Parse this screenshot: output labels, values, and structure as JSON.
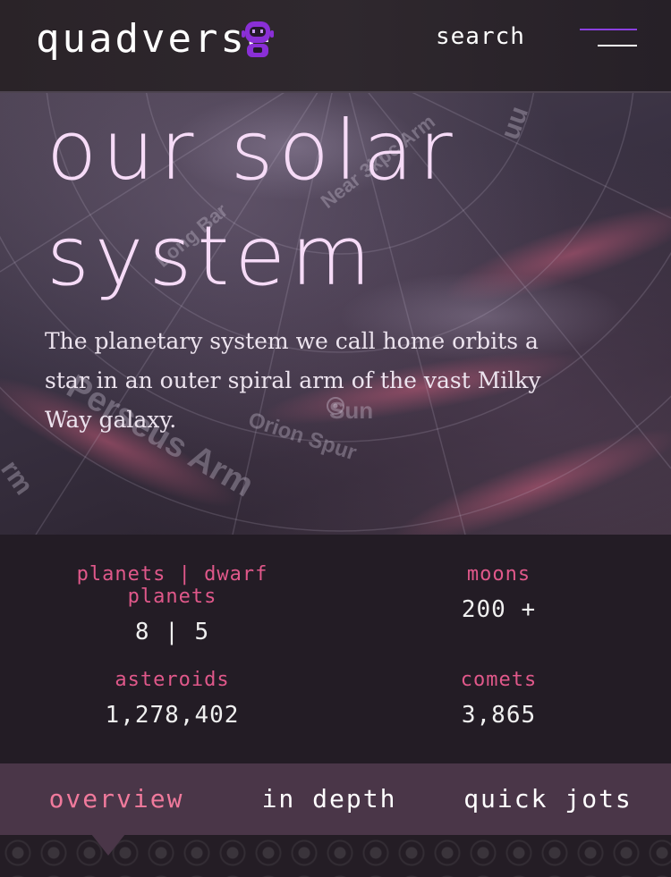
{
  "header": {
    "logo_text": "quadverse",
    "search_label": "search"
  },
  "hero": {
    "title_line1": "our solar",
    "title_line2": "system",
    "description": "The planetary system we call home orbits a star in an outer spiral arm of the vast Milky Way galaxy.",
    "map_labels": {
      "sun": "Sun",
      "orion_spur": "Orion Spur",
      "perseus_arm": "Perseus Arm",
      "near_arm": "Near 3kpc Arm",
      "long_bar": "Long Bar",
      "arm_fragment_left": "rm",
      "arm_fragment_right": "uu"
    }
  },
  "stats": [
    {
      "label": "planets | dwarf planets",
      "value": "8 | 5"
    },
    {
      "label": "moons",
      "value": "200 +"
    },
    {
      "label": "asteroids",
      "value": "1,278,402"
    },
    {
      "label": "comets",
      "value": "3,865"
    }
  ],
  "tabs": [
    {
      "label": "overview"
    },
    {
      "label": "in depth"
    },
    {
      "label": "quick jots"
    }
  ],
  "colors": {
    "accent": "#8b3fe0",
    "stat_label": "#e0588a",
    "active_tab": "#f07a9c",
    "tab_bar": "#4a3648",
    "title": "#f6dbf7"
  },
  "icons": {
    "logo_icon": "astronaut-icon",
    "menu_icon": "hamburger-menu-icon"
  }
}
